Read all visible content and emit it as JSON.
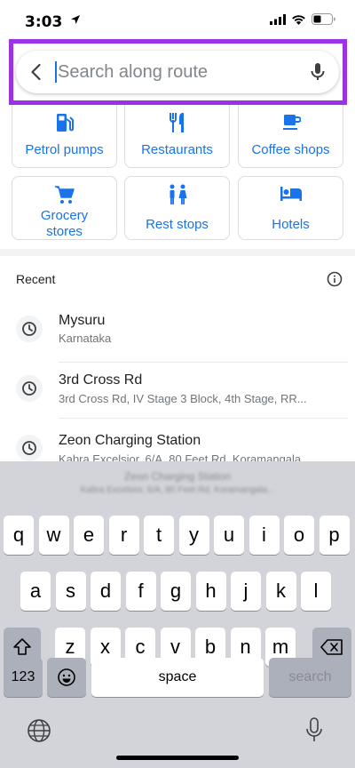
{
  "status_bar": {
    "time": "3:03"
  },
  "search": {
    "placeholder": "Search along route"
  },
  "categories": [
    {
      "label": "Petrol pumps",
      "icon": "gas-station-icon"
    },
    {
      "label": "Restaurants",
      "icon": "restaurant-icon"
    },
    {
      "label": "Coffee shops",
      "icon": "coffee-icon"
    },
    {
      "label_line1": "Grocery",
      "label_line2": "stores",
      "icon": "cart-icon"
    },
    {
      "label": "Rest stops",
      "icon": "restroom-icon"
    },
    {
      "label": "Hotels",
      "icon": "hotel-bed-icon"
    }
  ],
  "recent": {
    "title": "Recent",
    "items": [
      {
        "title": "Mysuru",
        "subtitle": "Karnataka"
      },
      {
        "title": "3rd Cross Rd",
        "subtitle": "3rd Cross Rd, IV Stage 3 Block, 4th Stage, RR..."
      },
      {
        "title": "Zeon Charging Station",
        "subtitle": "Kabra Excelsior, 6/A, 80 Feet Rd, Koramangala..."
      }
    ]
  },
  "keyboard": {
    "row1": [
      "q",
      "w",
      "e",
      "r",
      "t",
      "y",
      "u",
      "i",
      "o",
      "p"
    ],
    "row2": [
      "a",
      "s",
      "d",
      "f",
      "g",
      "h",
      "j",
      "k",
      "l"
    ],
    "row3": [
      "z",
      "x",
      "c",
      "v",
      "b",
      "n",
      "m"
    ],
    "numbers_key": "123",
    "space_key": "space",
    "search_key": "search"
  },
  "colors": {
    "accent": "#1a73e8",
    "highlight": "#9b32e6"
  }
}
